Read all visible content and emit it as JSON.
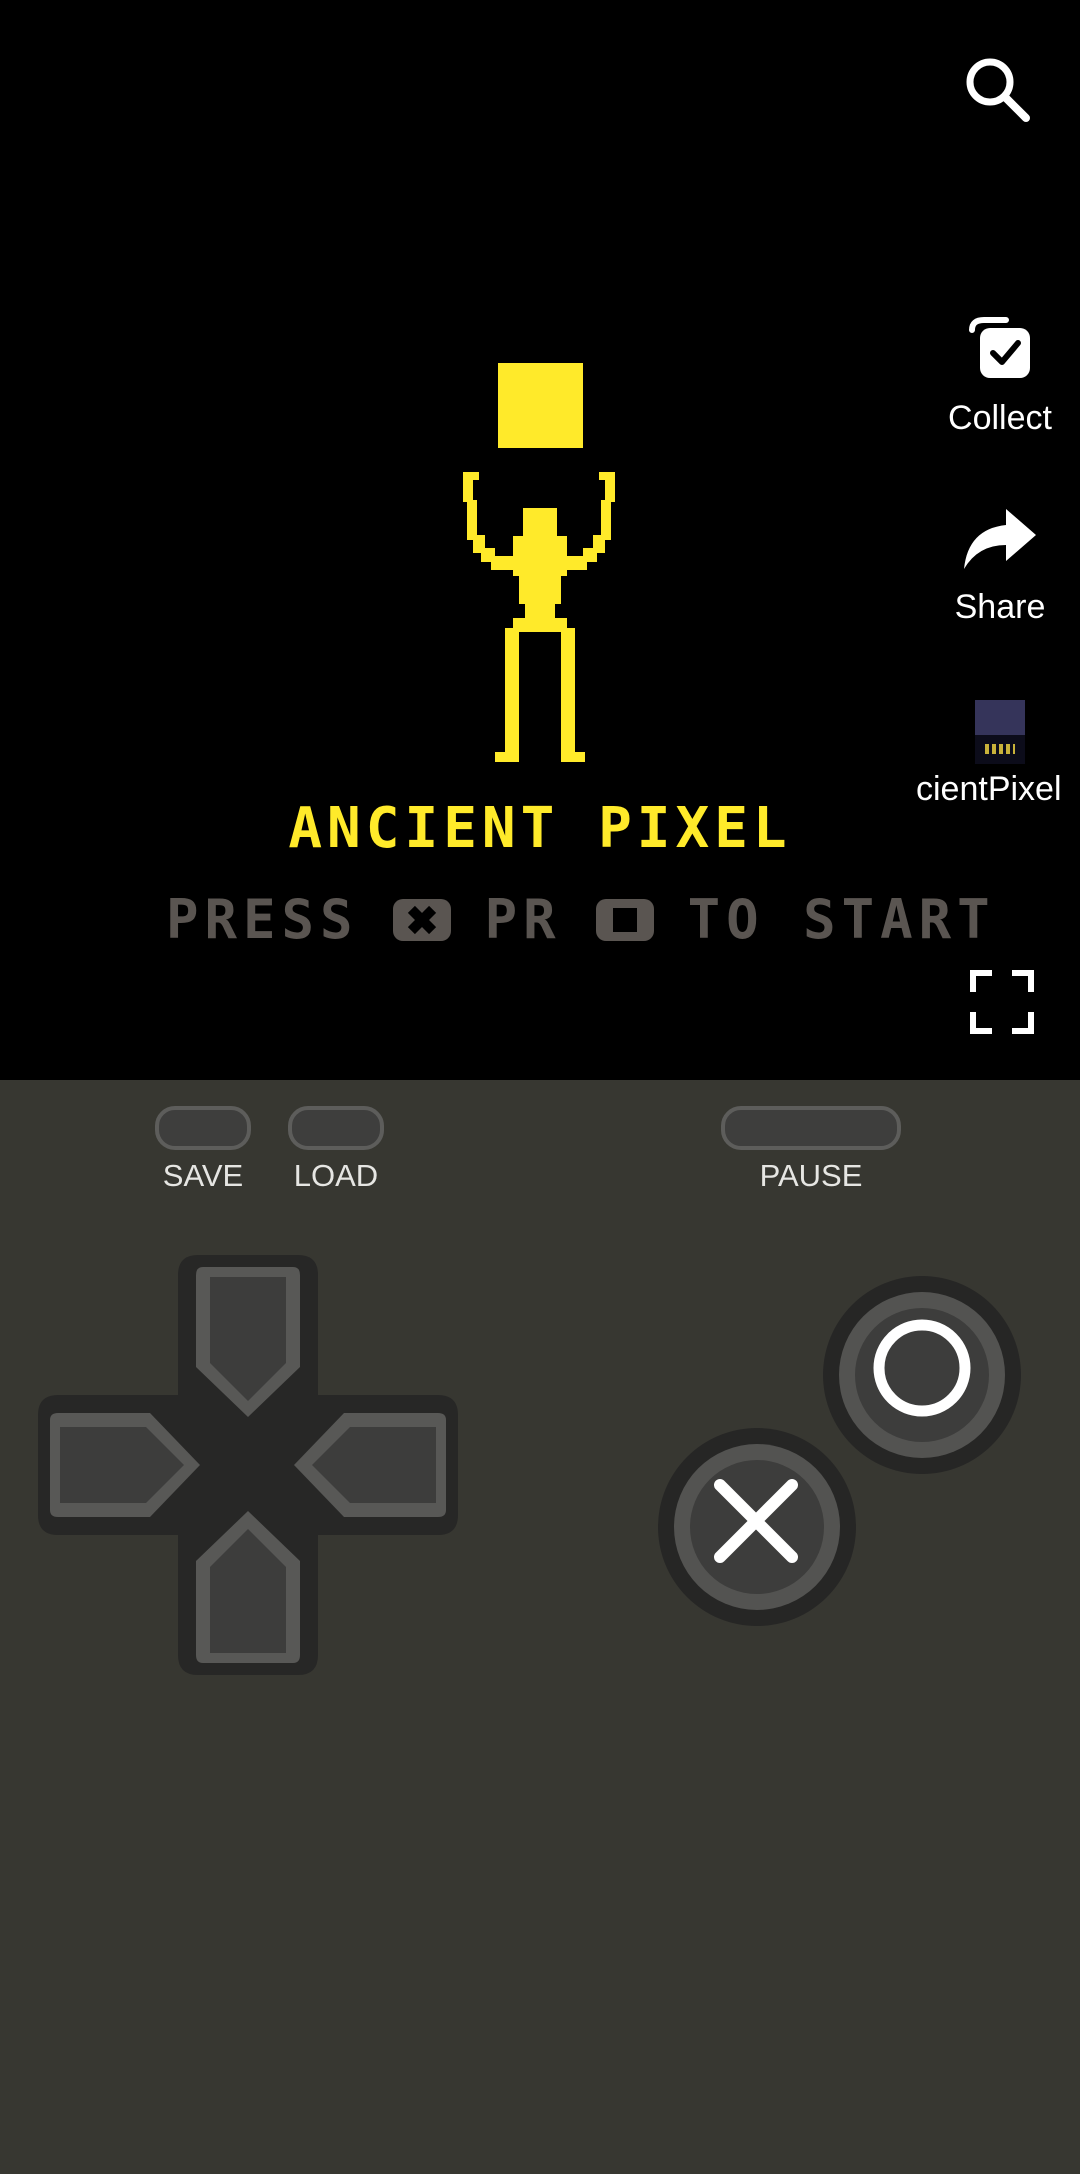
{
  "game": {
    "title": "ANCIENT PIXEL",
    "prompt": {
      "press": "PRESS",
      "or": "PR",
      "to_start": "TO START"
    },
    "colors": {
      "accent": "#ffea2a",
      "prompt": "#5a5551",
      "screen": "#000000",
      "controller": "#373731"
    }
  },
  "rail": {
    "search_icon": "search-icon",
    "collect_label": "Collect",
    "share_label": "Share",
    "profile_label": "cientPixel",
    "fullscreen_icon": "fullscreen-icon"
  },
  "controller": {
    "save_label": "SAVE",
    "load_label": "LOAD",
    "pause_label": "PAUSE",
    "dpad": [
      "up",
      "down",
      "left",
      "right"
    ],
    "face_buttons": [
      "circle",
      "cross"
    ]
  }
}
